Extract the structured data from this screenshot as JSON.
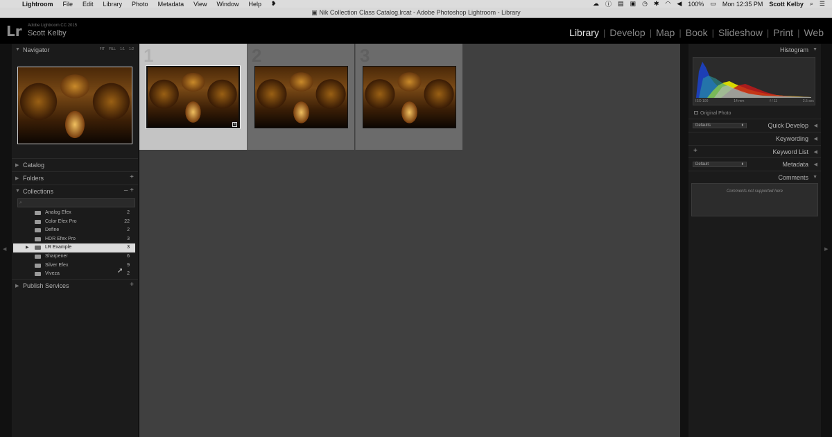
{
  "menubar": {
    "apple": "",
    "app_name": "Lightroom",
    "items": [
      "File",
      "Edit",
      "Library",
      "Photo",
      "Metadata",
      "View",
      "Window",
      "Help"
    ],
    "battery": "100%",
    "clock": "Mon 12:35 PM",
    "user": "Scott Kelby"
  },
  "window": {
    "title": "Nik Collection Class Catalog.lrcat - Adobe Photoshop Lightroom - Library"
  },
  "identity": {
    "logo": "Lr",
    "version": "Adobe Lightroom CC 2015",
    "user_name": "Scott Kelby"
  },
  "modules": {
    "library": "Library",
    "develop": "Develop",
    "map": "Map",
    "book": "Book",
    "slideshow": "Slideshow",
    "print": "Print",
    "web": "Web"
  },
  "left_panel": {
    "navigator": {
      "title": "Navigator",
      "options": [
        "FIT",
        "FILL",
        "1:1",
        "1:2"
      ]
    },
    "catalog": "Catalog",
    "folders": "Folders",
    "collections": {
      "title": "Collections",
      "items": [
        {
          "name": "Analog Efex",
          "count": "2"
        },
        {
          "name": "Color Efex Pro",
          "count": "22"
        },
        {
          "name": "Define",
          "count": "2"
        },
        {
          "name": "HDR Efex Pro",
          "count": "3"
        },
        {
          "name": "LR Example",
          "count": "3"
        },
        {
          "name": "Sharpener",
          "count": "6"
        },
        {
          "name": "Silver Efex",
          "count": "9"
        },
        {
          "name": "Viveza",
          "count": "2"
        }
      ]
    },
    "publish_services": "Publish Services"
  },
  "grid": {
    "cells": [
      {
        "index": "1"
      },
      {
        "index": "2"
      },
      {
        "index": "3"
      }
    ]
  },
  "right_panel": {
    "histogram": {
      "title": "Histogram",
      "iso": "ISO 100",
      "focal": "14 mm",
      "aperture": "f / 11",
      "shutter": "2.5 sec",
      "original_photo": "Original Photo"
    },
    "quick_develop": {
      "preset": "Defaults",
      "label": "Quick Develop"
    },
    "keywording": "Keywording",
    "keyword_list": "Keyword List",
    "metadata": {
      "preset": "Default",
      "label": "Metadata"
    },
    "comments": {
      "title": "Comments",
      "message": "Comments not supported here"
    }
  },
  "colors": {
    "accent_selected": "#dcdcdc",
    "panel": "#1b1b1b",
    "grid": "#404040"
  }
}
